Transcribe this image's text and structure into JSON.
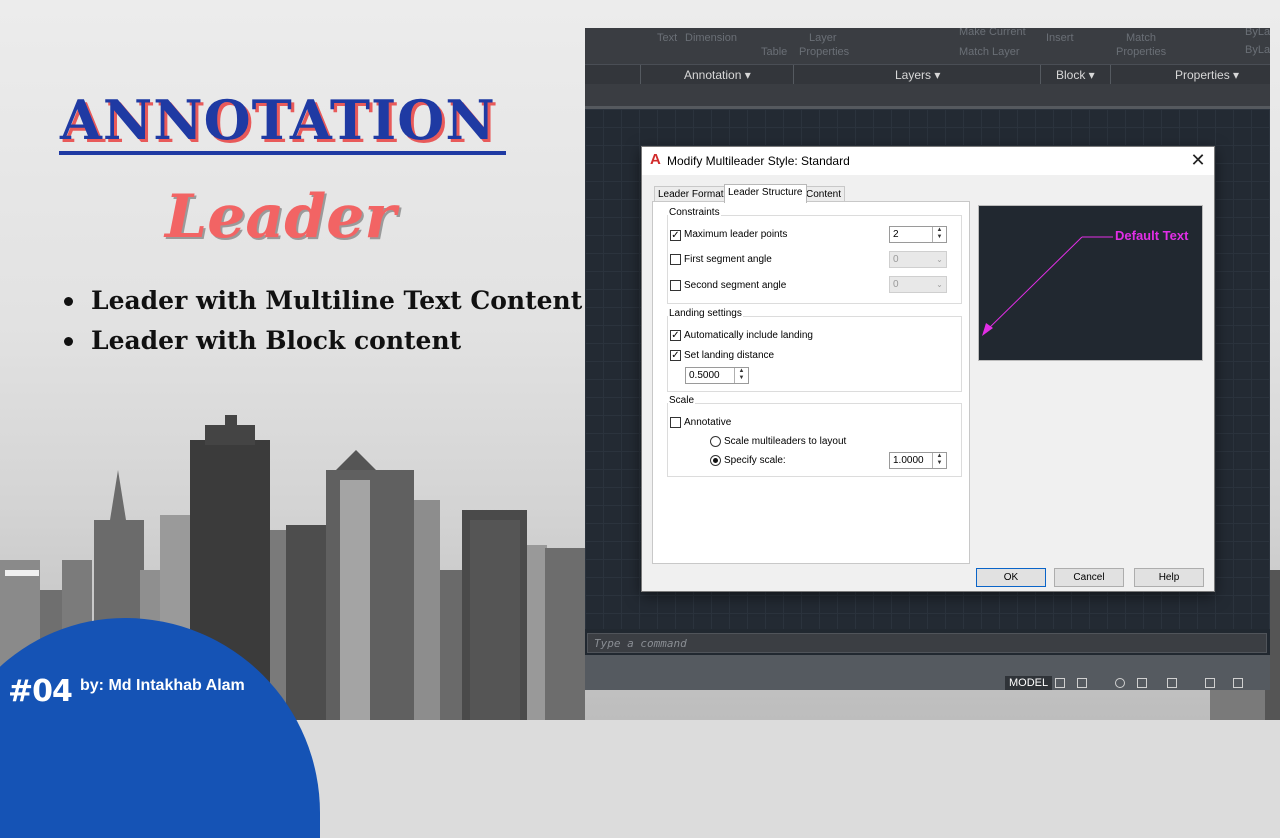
{
  "slide": {
    "title": "ANNOTATION",
    "subtitle": "Leader",
    "bullets": [
      "Leader with Multiline Text Content",
      "Leader with Block content"
    ],
    "episode": "#04",
    "author": "by: Md Intakhab Alam"
  },
  "cad": {
    "ribbon_faint": [
      "Text",
      "Dimension",
      "Table",
      "Layer",
      "Properties",
      "Make Current",
      "Match Layer",
      "Insert",
      "Match",
      "Properties",
      "ByLayer",
      "ByLayer"
    ],
    "panels": [
      "Annotation",
      "Layers",
      "Block",
      "Properties"
    ],
    "command_placeholder": "Type a command",
    "status_model": "MODEL"
  },
  "dialog": {
    "title": "Modify Multileader Style: Standard",
    "logo": "A",
    "close": "✕",
    "tabs": [
      "Leader Format",
      "Leader Structure",
      "Content"
    ],
    "constraints": {
      "label": "Constraints",
      "max_points": {
        "label": "Maximum leader points",
        "checked": true,
        "value": "2"
      },
      "first_angle": {
        "label": "First segment angle",
        "checked": false,
        "value": "0"
      },
      "second_angle": {
        "label": "Second segment angle",
        "checked": false,
        "value": "0"
      }
    },
    "landing": {
      "label": "Landing settings",
      "auto_include": {
        "label": "Automatically include landing",
        "checked": true
      },
      "set_distance": {
        "label": "Set landing distance",
        "checked": true
      },
      "distance_value": "0.5000"
    },
    "scale": {
      "label": "Scale",
      "annotative": {
        "label": "Annotative",
        "checked": false
      },
      "to_layout": {
        "label": "Scale multileaders to layout",
        "selected": false
      },
      "specify": {
        "label": "Specify scale:",
        "selected": true,
        "value": "1.0000"
      }
    },
    "preview_text": "Default Text",
    "buttons": {
      "ok": "OK",
      "cancel": "Cancel",
      "help": "Help"
    }
  },
  "colors": {
    "title_blue": "#1f3aa3",
    "leader_red": "#f26464",
    "leader_magenta": "#e22ee6",
    "badge_blue": "#1553b5"
  },
  "icons": [
    "autocad-logo-icon",
    "close-icon",
    "checkmark-icon",
    "spinner-arrows-icon",
    "dropdown-arrow-icon",
    "grid-icon"
  ]
}
